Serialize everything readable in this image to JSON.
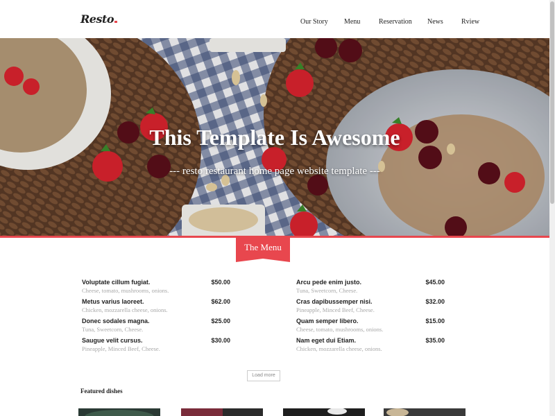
{
  "header": {
    "logo": "Resto",
    "nav": [
      "Our Story",
      "Menu",
      "Reservation",
      "News",
      "Rview"
    ]
  },
  "hero": {
    "title": "This Template Is Awesome",
    "subtitle": "--- resto restaurant home page website template ---"
  },
  "menu_section": {
    "title": "The Menu",
    "left": [
      {
        "name": "Voluptate cillum fugiat.",
        "desc": "Cheese, tomato, mushrooms, onions.",
        "price": "$50.00"
      },
      {
        "name": "Metus varius laoreet.",
        "desc": "Chicken, mozzarella cheese, onions.",
        "price": "$62.00"
      },
      {
        "name": "Donec sodales magna.",
        "desc": "Tuna, Sweetcorn, Cheese.",
        "price": "$25.00"
      },
      {
        "name": "Saugue velit cursus.",
        "desc": "Pineapple, Minced Beef, Cheese.",
        "price": "$30.00"
      }
    ],
    "right": [
      {
        "name": "Arcu pede enim justo.",
        "desc": "Tuna, Sweetcorn, Cheese.",
        "price": "$45.00"
      },
      {
        "name": "Cras dapibussemper nisi.",
        "desc": "Pineapple, Minced Beef, Cheese.",
        "price": "$32.00"
      },
      {
        "name": "Quam semper libero.",
        "desc": "Cheese, tomato, mushrooms, onions.",
        "price": "$15.00"
      },
      {
        "name": "Nam eget dui Etiam.",
        "desc": "Chicken, mozzarella cheese, onions.",
        "price": "$35.00"
      }
    ],
    "load_more": "Load more"
  },
  "featured": {
    "title": "Featured dishes"
  },
  "colors": {
    "accent": "#e8474e"
  }
}
